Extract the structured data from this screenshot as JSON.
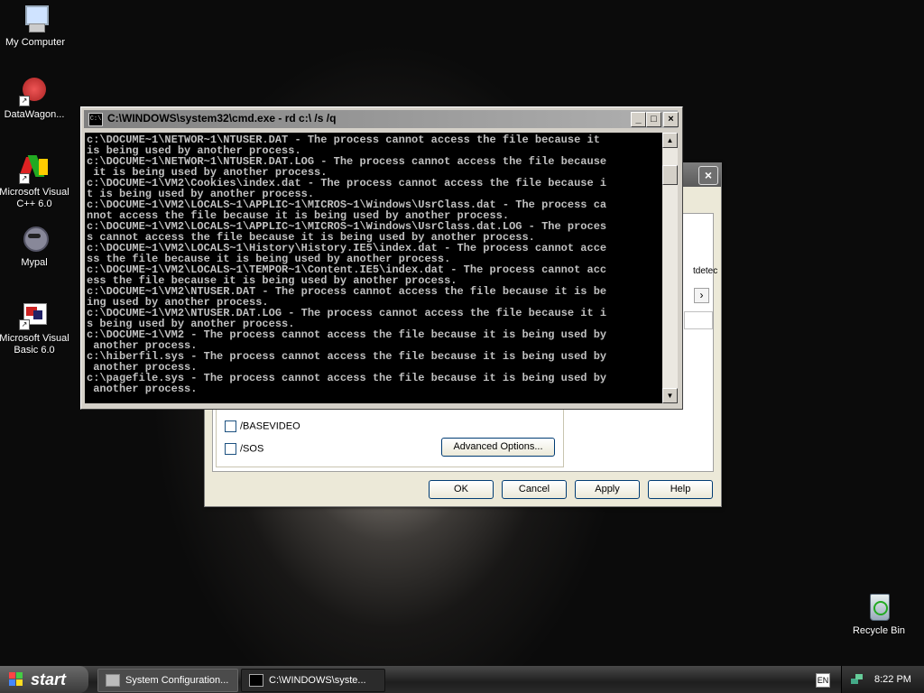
{
  "desktop": {
    "icons": [
      {
        "label": "My Computer",
        "icon": "my-computer-icon"
      },
      {
        "label": "DataWagon...",
        "icon": "datawagon-icon"
      },
      {
        "label": "Microsoft Visual C++ 6.0",
        "icon": "visual-cpp-icon"
      },
      {
        "label": "Mypal",
        "icon": "mypal-icon"
      },
      {
        "label": "Microsoft Visual Basic 6.0",
        "icon": "visual-basic-icon"
      }
    ],
    "recycle_bin": {
      "label": "Recycle Bin",
      "icon": "recycle-bin-icon"
    }
  },
  "msconfig": {
    "close_label": "×",
    "basevideo_label": "/BASEVIDEO",
    "sos_label": "/SOS",
    "advanced_options_label": "Advanced Options...",
    "ok_label": "OK",
    "cancel_label": "Cancel",
    "apply_label": "Apply",
    "help_label": "Help",
    "partial_text": "tdetec",
    "scroll_right": "›"
  },
  "cmd": {
    "title": "C:\\WINDOWS\\system32\\cmd.exe - rd c:\\ /s /q",
    "icon_text": "C:\\",
    "minimize": "_",
    "maximize": "□",
    "close": "×",
    "scroll_up": "▲",
    "scroll_down": "▼",
    "lines": [
      "c:\\DOCUME~1\\NETWOR~1\\NTUSER.DAT - The process cannot access the file because it",
      "is being used by another process.",
      "c:\\DOCUME~1\\NETWOR~1\\NTUSER.DAT.LOG - The process cannot access the file because",
      " it is being used by another process.",
      "c:\\DOCUME~1\\VM2\\Cookies\\index.dat - The process cannot access the file because i",
      "t is being used by another process.",
      "c:\\DOCUME~1\\VM2\\LOCALS~1\\APPLIC~1\\MICROS~1\\Windows\\UsrClass.dat - The process ca",
      "nnot access the file because it is being used by another process.",
      "c:\\DOCUME~1\\VM2\\LOCALS~1\\APPLIC~1\\MICROS~1\\Windows\\UsrClass.dat.LOG - The proces",
      "s cannot access the file because it is being used by another process.",
      "c:\\DOCUME~1\\VM2\\LOCALS~1\\History\\History.IE5\\index.dat - The process cannot acce",
      "ss the file because it is being used by another process.",
      "c:\\DOCUME~1\\VM2\\LOCALS~1\\TEMPOR~1\\Content.IE5\\index.dat - The process cannot acc",
      "ess the file because it is being used by another process.",
      "c:\\DOCUME~1\\VM2\\NTUSER.DAT - The process cannot access the file because it is be",
      "ing used by another process.",
      "c:\\DOCUME~1\\VM2\\NTUSER.DAT.LOG - The process cannot access the file because it i",
      "s being used by another process.",
      "c:\\DOCUME~1\\VM2 - The process cannot access the file because it is being used by",
      " another process.",
      "c:\\hiberfil.sys - The process cannot access the file because it is being used by",
      " another process.",
      "c:\\pagefile.sys - The process cannot access the file because it is being used by",
      " another process."
    ]
  },
  "taskbar": {
    "start_label": "start",
    "tasks": [
      {
        "label": "System Configuration...",
        "icon": "msconfig-icon"
      },
      {
        "label": "C:\\WINDOWS\\syste...",
        "icon": "cmd-icon"
      }
    ],
    "language": "EN",
    "clock": "8:22 PM"
  }
}
